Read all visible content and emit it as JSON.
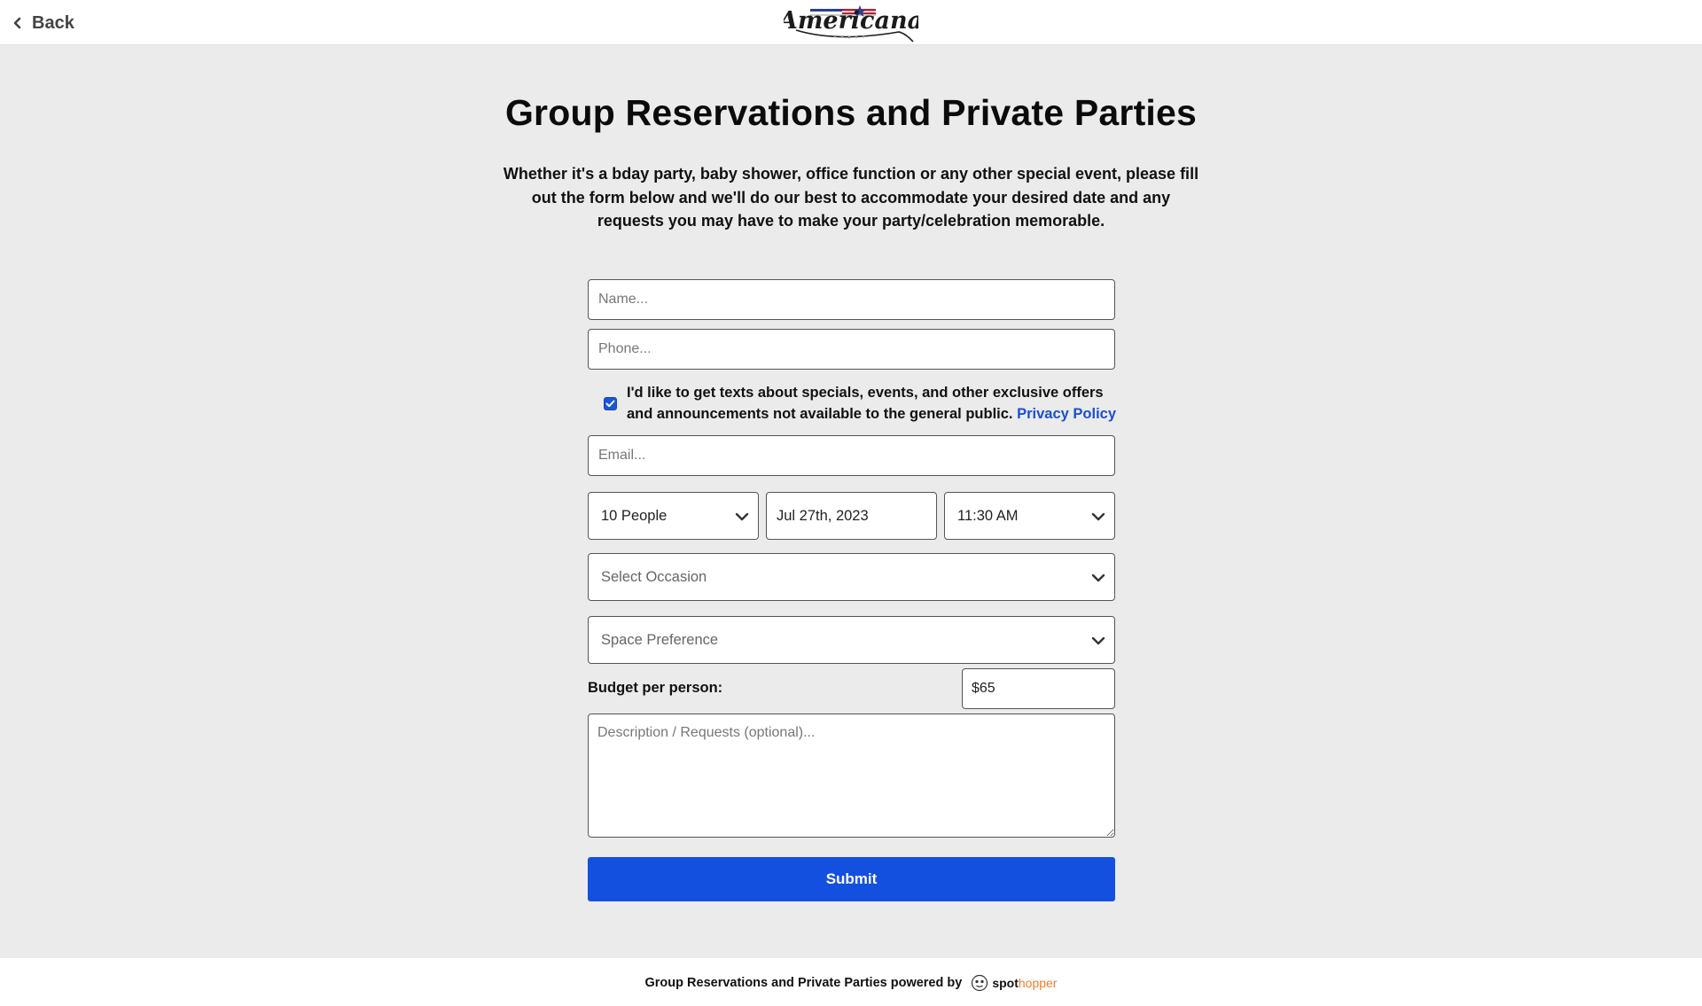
{
  "header": {
    "back_label": "Back",
    "logo_text": "Americana"
  },
  "page": {
    "title": "Group Reservations and Private Parties",
    "intro": "Whether it's a bday party, baby shower, office function or any other special event, please fill out the form below and we'll do our best to accommodate your desired date and any requests you may have to make your party/celebration memorable."
  },
  "form": {
    "name_placeholder": "Name...",
    "phone_placeholder": "Phone...",
    "consent_checked": true,
    "consent_text": "I'd like to get texts about specials, events, and other exclusive offers and announcements not available to the general public.",
    "privacy_link": "Privacy Policy",
    "email_placeholder": "Email...",
    "party_size": "10 People",
    "date": "Jul 27th, 2023",
    "time": "11:30 AM",
    "occasion_placeholder": "Select Occasion",
    "space_placeholder": "Space Preference",
    "budget_label": "Budget per person:",
    "budget_value": "$65",
    "description_placeholder": "Description / Requests (optional)...",
    "submit_label": "Submit"
  },
  "footer": {
    "text": "Group Reservations and Private Parties powered by",
    "brand_spot": "spot",
    "brand_hopper": "hopper"
  },
  "colors": {
    "primary": "#1450e0",
    "link": "#1a4fd1",
    "background": "#ebebeb",
    "brand_orange": "#f07c2a"
  }
}
